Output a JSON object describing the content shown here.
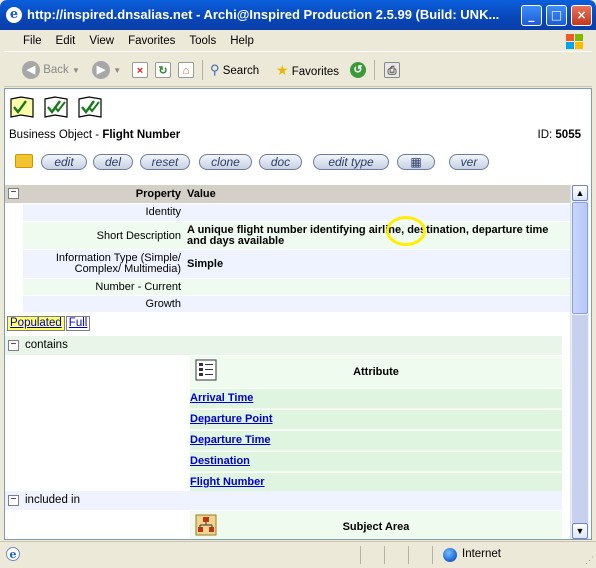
{
  "window": {
    "title": "http://inspired.dnsalias.net - Archi@Inspired Production 2.5.99 (Build: UNK...",
    "minimize": "_",
    "maximize": "□",
    "close": "×"
  },
  "menu": [
    "File",
    "Edit",
    "View",
    "Favorites",
    "Tools",
    "Help"
  ],
  "toolbar": {
    "back": "Back",
    "search": "Search",
    "favorites": "Favorites"
  },
  "page": {
    "business_object_label": "Business Object - ",
    "business_object_name": "Flight Number",
    "id_label": "ID: ",
    "id_value": "5055",
    "actions": [
      "edit",
      "del",
      "reset",
      "clone",
      "doc",
      "edit type",
      "ver"
    ],
    "properties": {
      "header_property": "Property",
      "header_value": "Value",
      "rows": [
        {
          "label": "Identity",
          "value": ""
        },
        {
          "label": "Short Description",
          "value": "A unique flight number identifying airline, destination, departure time and days available"
        },
        {
          "label": "Information Type (Simple/ Complex/ Multimedia)",
          "value": "Simple"
        },
        {
          "label": "Number - Current",
          "value": ""
        },
        {
          "label": "Growth",
          "value": ""
        }
      ]
    },
    "tabs": {
      "populated": "Populated",
      "full": "Full"
    },
    "contains": {
      "label": "contains",
      "heading": "Attribute",
      "items": [
        "Arrival Time",
        "Departure Point",
        "Departure Time",
        "Destination",
        "Flight Number"
      ]
    },
    "included_in": {
      "label": "included in",
      "heading": "Subject Area"
    }
  },
  "status": {
    "zone": "Internet"
  },
  "colors": {
    "title_bar": "#0846b8",
    "highlight_circle": "#ffee00",
    "link": "#0000cc",
    "active_tab": "#ffff66"
  }
}
